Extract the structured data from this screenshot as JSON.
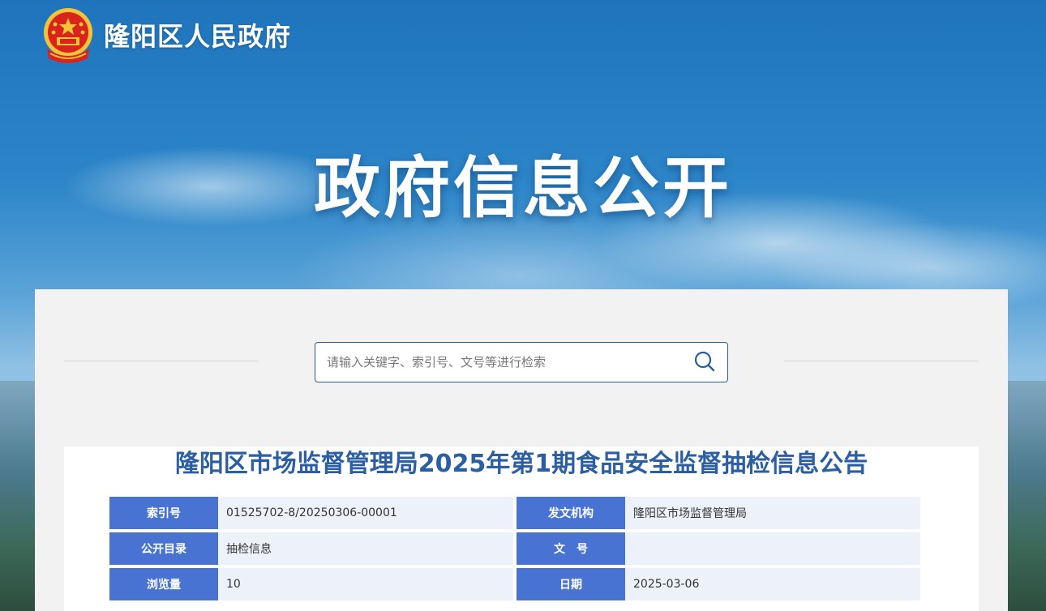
{
  "header": {
    "site_name": "隆阳区人民政府",
    "hero_title": "政府信息公开"
  },
  "search": {
    "placeholder": "请输入关键字、索引号、文号等进行检索"
  },
  "article": {
    "title": "隆阳区市场监督管理局2025年第1期食品安全监督抽检信息公告",
    "meta": [
      {
        "label_left": "索引号",
        "value_left": "01525702-8/20250306-00001",
        "label_right": "发文机构",
        "value_right": "隆阳区市场监督管理局"
      },
      {
        "label_left": "公开目录",
        "value_left": "抽检信息",
        "label_right": "文　号",
        "value_right": ""
      },
      {
        "label_left": "浏览量",
        "value_left": "10",
        "label_right": "日期",
        "value_right": "2025-03-06"
      }
    ]
  },
  "colors": {
    "accent": "#2c5ea3",
    "label_bg": "#4873d2",
    "value_bg": "#edf1f9"
  },
  "icons": {
    "logo": "national-emblem-icon",
    "search": "search-icon"
  }
}
